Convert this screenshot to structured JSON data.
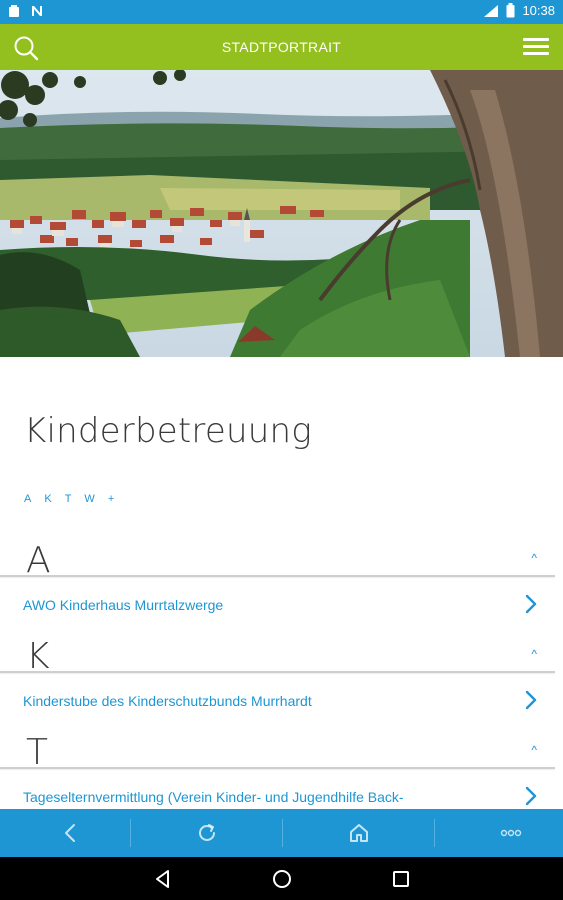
{
  "status_bar": {
    "time": "10:38",
    "icons": [
      "notification-icon",
      "n-icon",
      "signal-icon",
      "battery-icon"
    ]
  },
  "app_bar": {
    "title": "STADTPORTRAIT",
    "search_icon": "search-icon",
    "menu_icon": "menu-icon",
    "background": "#93c01f"
  },
  "hero": {
    "image": "landscape-photo"
  },
  "content": {
    "title": "Kinderbetreuung",
    "jump_nav": [
      "A",
      "K",
      "T",
      "W",
      "+"
    ],
    "sections": [
      {
        "letter": "A",
        "toggle": "^",
        "entries": [
          "AWO Kinderhaus Murrtalzwerge"
        ]
      },
      {
        "letter": "K",
        "toggle": "^",
        "entries": [
          "Kinderstube des Kinderschutzbunds Murrhardt"
        ]
      },
      {
        "letter": "T",
        "toggle": "^",
        "entries": [
          "Tageselternvermittlung (Verein Kinder- und Jugendhilfe Back-"
        ]
      }
    ]
  },
  "bottom_bar": {
    "items": [
      "back-icon",
      "reload-icon",
      "home-icon",
      "more-icon"
    ]
  },
  "nav_bar": {
    "items": [
      "back-triangle-icon",
      "home-circle-icon",
      "recents-square-icon"
    ]
  },
  "colors": {
    "accent_blue": "#1e96d4",
    "accent_green": "#93c01f"
  }
}
